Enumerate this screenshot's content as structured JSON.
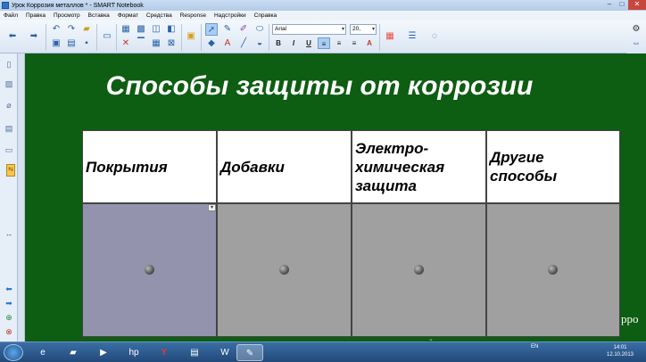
{
  "window": {
    "title": "Урок Коррозия металлов * - SMART Notebook",
    "controls": {
      "minimize": "–",
      "maximize": "□",
      "close": "✕"
    }
  },
  "menu": [
    "Файл",
    "Правка",
    "Просмотр",
    "Вставка",
    "Формат",
    "Средства",
    "Response",
    "Надстройки",
    "Справка"
  ],
  "toolbar": {
    "font": "Arial",
    "size": "20,",
    "bold": "B",
    "italic": "I",
    "underline": "U"
  },
  "slide": {
    "title": "Способы защиты от коррозии",
    "table": {
      "headers": [
        "Покрытия",
        "Добавки",
        "Электро-\nхимическая\nзащита",
        "Другие\nспособы"
      ]
    },
    "partial_text": "ppo"
  },
  "taskbar": {
    "lang": "EN",
    "time": "14:01",
    "date": "12.10.2013"
  }
}
